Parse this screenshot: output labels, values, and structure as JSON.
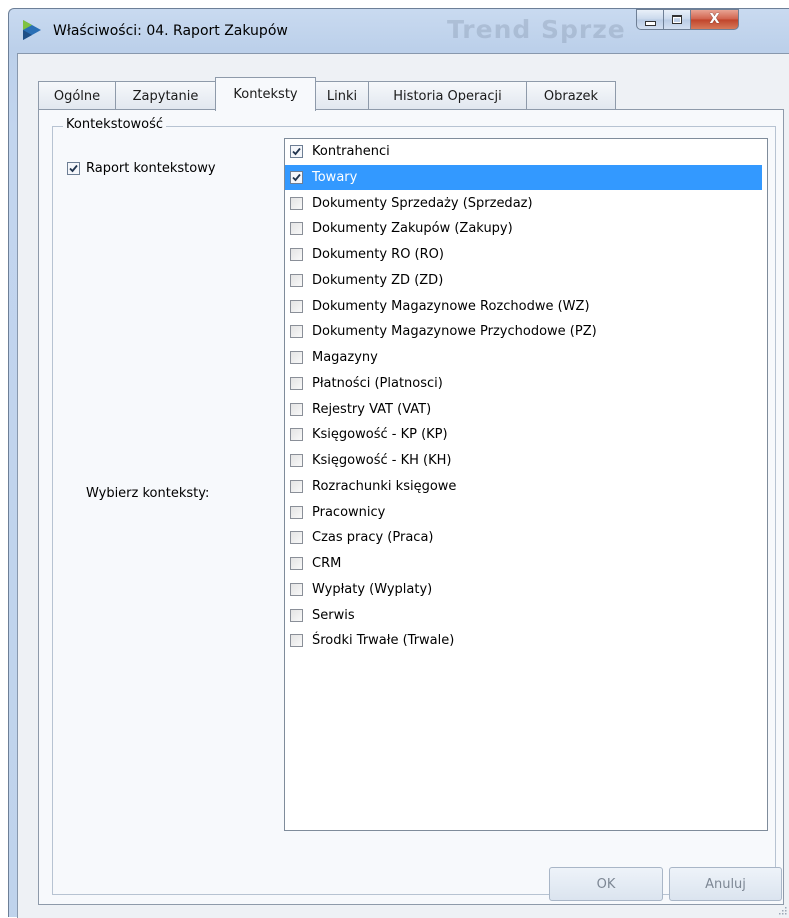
{
  "window": {
    "title": "Właściwości: 04. Raport Zakupów",
    "background_title": "Trend Sprze",
    "caption": {
      "minimize": "minimize",
      "maximize": "maximize",
      "close": "X"
    }
  },
  "tabs": [
    {
      "label": "Ogólne",
      "active": false
    },
    {
      "label": "Zapytanie",
      "active": false
    },
    {
      "label": "Konteksty",
      "active": true
    },
    {
      "label": "Linki",
      "active": false
    },
    {
      "label": "Historia Operacji",
      "active": false
    },
    {
      "label": "Obrazek",
      "active": false
    }
  ],
  "group": {
    "title": "Kontekstowość",
    "raport_kontekstowy": {
      "label": "Raport kontekstowy",
      "checked": true
    },
    "contexts_label": "Wybierz konteksty:",
    "contexts": [
      {
        "label": "Kontrahenci",
        "checked": true,
        "selected": false
      },
      {
        "label": "Towary",
        "checked": true,
        "selected": true
      },
      {
        "label": "Dokumenty Sprzedaży (Sprzedaz)",
        "checked": false,
        "selected": false
      },
      {
        "label": "Dokumenty Zakupów (Zakupy)",
        "checked": false,
        "selected": false
      },
      {
        "label": "Dokumenty RO (RO)",
        "checked": false,
        "selected": false
      },
      {
        "label": "Dokumenty ZD (ZD)",
        "checked": false,
        "selected": false
      },
      {
        "label": "Dokumenty Magazynowe Rozchodwe (WZ)",
        "checked": false,
        "selected": false
      },
      {
        "label": "Dokumenty Magazynowe Przychodowe (PZ)",
        "checked": false,
        "selected": false
      },
      {
        "label": "Magazyny",
        "checked": false,
        "selected": false
      },
      {
        "label": "Płatności (Platnosci)",
        "checked": false,
        "selected": false
      },
      {
        "label": "Rejestry VAT (VAT)",
        "checked": false,
        "selected": false
      },
      {
        "label": "Księgowość - KP (KP)",
        "checked": false,
        "selected": false
      },
      {
        "label": "Księgowość - KH (KH)",
        "checked": false,
        "selected": false
      },
      {
        "label": "Rozrachunki księgowe",
        "checked": false,
        "selected": false
      },
      {
        "label": "Pracownicy",
        "checked": false,
        "selected": false
      },
      {
        "label": "Czas pracy (Praca)",
        "checked": false,
        "selected": false
      },
      {
        "label": "CRM",
        "checked": false,
        "selected": false
      },
      {
        "label": "Wypłaty (Wyplaty)",
        "checked": false,
        "selected": false
      },
      {
        "label": "Serwis",
        "checked": false,
        "selected": false
      },
      {
        "label": "Środki Trwałe (Trwale)",
        "checked": false,
        "selected": false
      }
    ]
  },
  "buttons": {
    "ok": "OK",
    "cancel": "Anuluj"
  },
  "colors": {
    "selection": "#3399ff",
    "client_bg": "#eef1f5",
    "frame": "#c2d5ee"
  }
}
